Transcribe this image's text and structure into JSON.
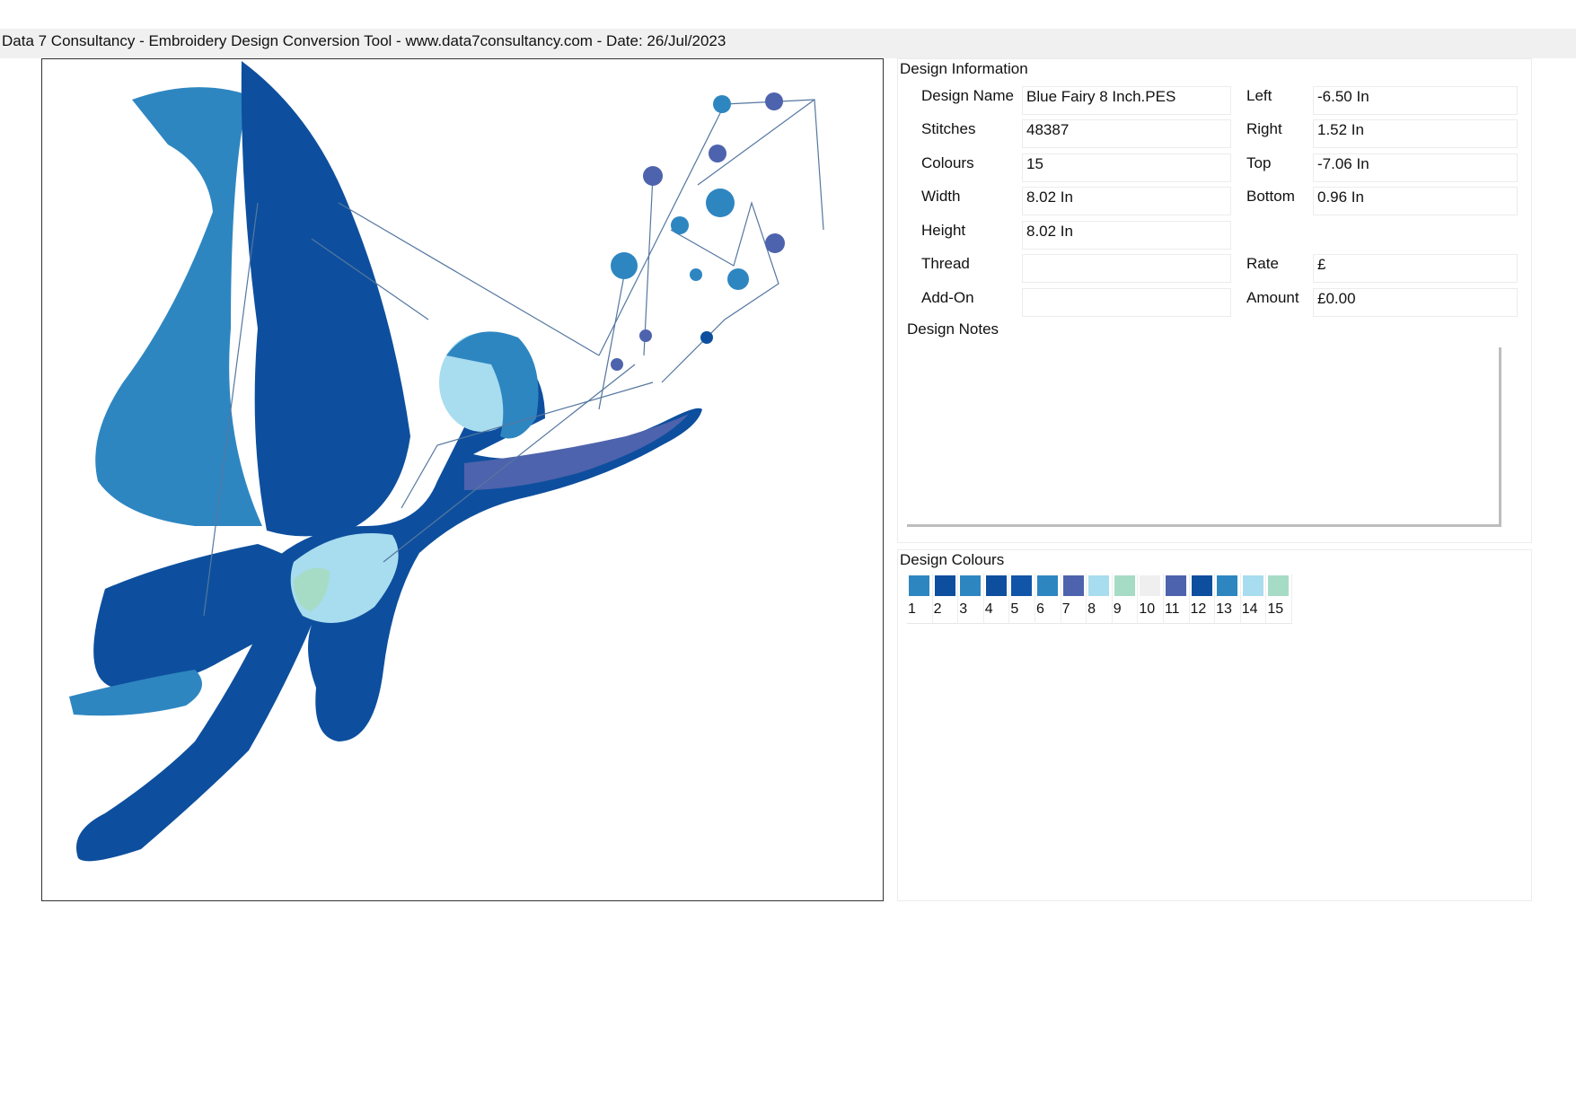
{
  "header": {
    "title": "Data 7 Consultancy - Embroidery Design Conversion Tool - www.data7consultancy.com - Date: 26/Jul/2023"
  },
  "design_info": {
    "section_title": "Design Information",
    "labels": {
      "design_name": "Design Name",
      "stitches": "Stitches",
      "colours": "Colours",
      "width": "Width",
      "height": "Height",
      "thread": "Thread",
      "add_on": "Add-On",
      "left": "Left",
      "right": "Right",
      "top": "Top",
      "bottom": "Bottom",
      "rate": "Rate",
      "amount": "Amount"
    },
    "values": {
      "design_name": "Blue Fairy 8 Inch.PES",
      "stitches": "48387",
      "colours": "15",
      "width": "8.02 In",
      "height": "8.02 In",
      "thread": "",
      "add_on": "",
      "left": "-6.50 In",
      "right": "1.52 In",
      "top": "-7.06 In",
      "bottom": "0.96 In",
      "rate": "£",
      "amount": "£0.00"
    },
    "notes_label": "Design Notes",
    "notes_value": ""
  },
  "design_colours": {
    "section_title": "Design Colours",
    "swatches": [
      {
        "number": "1",
        "color": "#2e86c1"
      },
      {
        "number": "2",
        "color": "#0d4f9e"
      },
      {
        "number": "3",
        "color": "#2e86c1"
      },
      {
        "number": "4",
        "color": "#0d4f9e"
      },
      {
        "number": "5",
        "color": "#1155a8"
      },
      {
        "number": "6",
        "color": "#2e86c1"
      },
      {
        "number": "7",
        "color": "#4e63ad"
      },
      {
        "number": "8",
        "color": "#a8dcef"
      },
      {
        "number": "9",
        "color": "#a6dcc6"
      },
      {
        "number": "10",
        "color": "#efefef"
      },
      {
        "number": "11",
        "color": "#4e63ad"
      },
      {
        "number": "12",
        "color": "#0d4f9e"
      },
      {
        "number": "13",
        "color": "#2e86c1"
      },
      {
        "number": "14",
        "color": "#a8dcef"
      },
      {
        "number": "15",
        "color": "#a6dcc6"
      }
    ]
  },
  "preview": {
    "subject": "blue-fairy-embroidery",
    "colors": {
      "light_blue": "#2e86c1",
      "dark_blue": "#0d4f9e",
      "purple": "#4e63ad",
      "pale_blue": "#a8dcef",
      "mint": "#a6dcc6",
      "jump_stitch": "#5577a0"
    }
  }
}
